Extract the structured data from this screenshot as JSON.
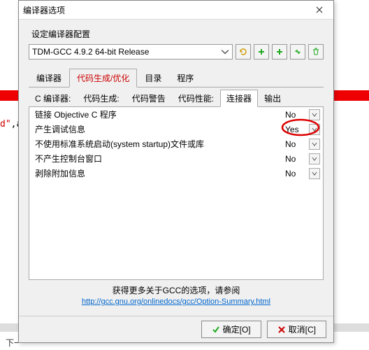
{
  "bg": {
    "code_str": "d\"",
    "code_rest": ",a",
    "footer": "下一"
  },
  "dialog": {
    "title": "编译器选项",
    "config_label": "设定编译器配置",
    "compiler_selected": "TDM-GCC 4.9.2 64-bit Release",
    "tabs": [
      "编译器",
      "代码生成/优化",
      "目录",
      "程序"
    ],
    "subtabs": [
      "C 编译器:",
      "代码生成:",
      "代码警告",
      "代码性能:",
      "连接器",
      "输出"
    ],
    "options": [
      {
        "label": "链接 Objective C 程序",
        "value": "No"
      },
      {
        "label": "产生调试信息",
        "value": "Yes"
      },
      {
        "label": "不使用标准系统启动(system startup)文件或库",
        "value": "No"
      },
      {
        "label": "不产生控制台窗口",
        "value": "No"
      },
      {
        "label": "剥除附加信息",
        "value": "No"
      }
    ],
    "footer_text": "获得更多关于GCC的选项，请参阅",
    "footer_link": "http://gcc.gnu.org/onlinedocs/gcc/Option-Summary.html",
    "ok_btn": "确定[O]",
    "cancel_btn": "取消[C]"
  },
  "watermark": ""
}
